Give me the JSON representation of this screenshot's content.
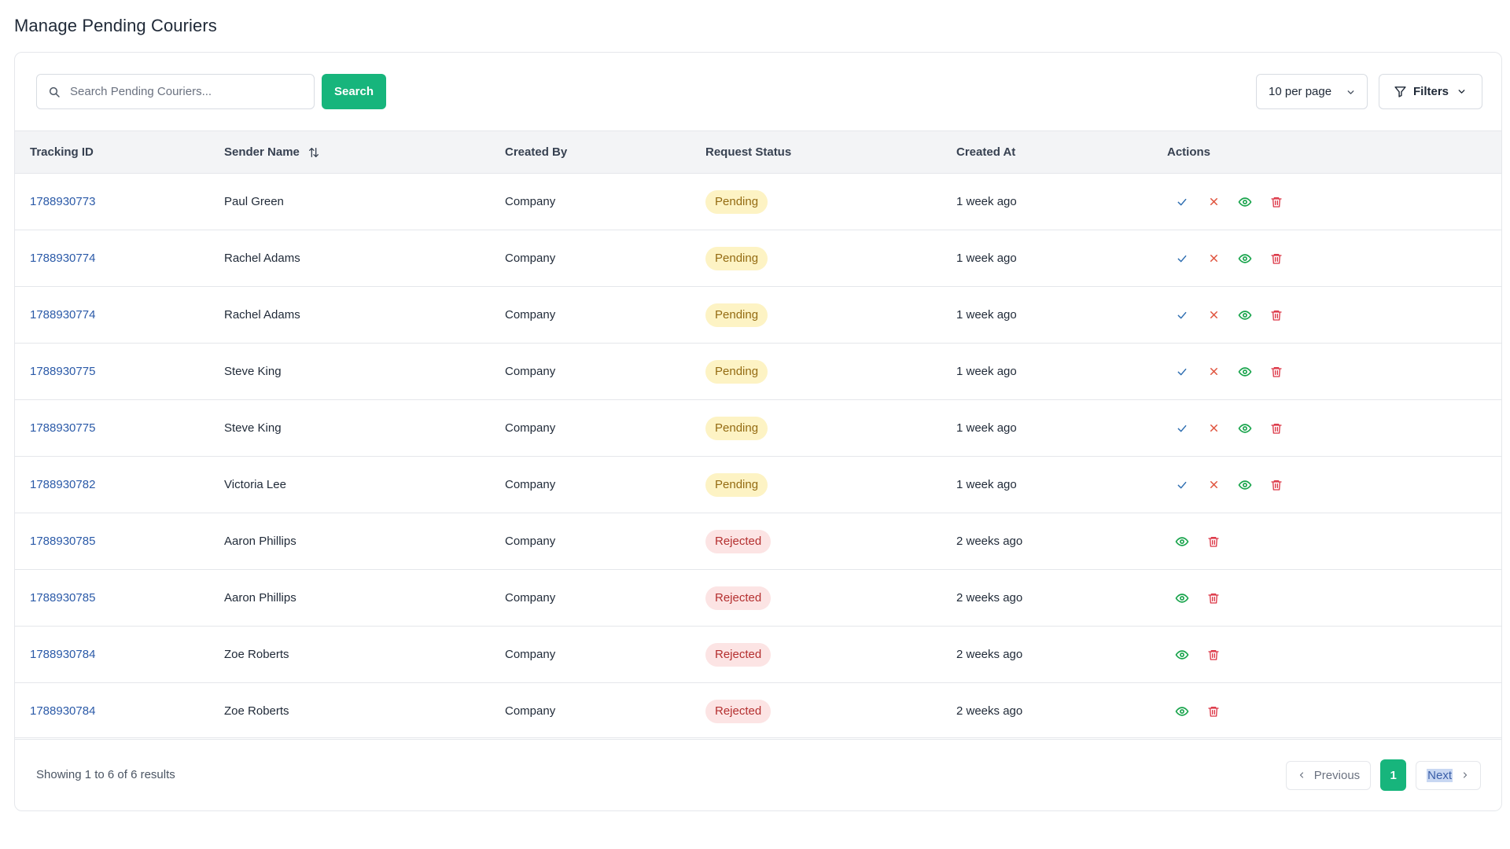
{
  "page": {
    "title": "Manage Pending Couriers"
  },
  "toolbar": {
    "search_placeholder": "Search Pending Couriers...",
    "search_label": "Search",
    "per_page": "10 per page",
    "filters_label": "Filters"
  },
  "table": {
    "headers": [
      "Tracking ID",
      "Sender Name",
      "Created By",
      "Request Status",
      "Created At",
      "Actions"
    ],
    "rows": [
      {
        "tracking_id": "1788930773",
        "sender": "Paul Green",
        "created_by": "Company",
        "status": "Pending",
        "created_at": "1 week ago"
      },
      {
        "tracking_id": "1788930774",
        "sender": "Rachel Adams",
        "created_by": "Company",
        "status": "Pending",
        "created_at": "1 week ago"
      },
      {
        "tracking_id": "1788930774",
        "sender": "Rachel Adams",
        "created_by": "Company",
        "status": "Pending",
        "created_at": "1 week ago"
      },
      {
        "tracking_id": "1788930775",
        "sender": "Steve King",
        "created_by": "Company",
        "status": "Pending",
        "created_at": "1 week ago"
      },
      {
        "tracking_id": "1788930775",
        "sender": "Steve King",
        "created_by": "Company",
        "status": "Pending",
        "created_at": "1 week ago"
      },
      {
        "tracking_id": "1788930782",
        "sender": "Victoria Lee",
        "created_by": "Company",
        "status": "Pending",
        "created_at": "1 week ago"
      },
      {
        "tracking_id": "1788930785",
        "sender": "Aaron Phillips",
        "created_by": "Company",
        "status": "Rejected",
        "created_at": "2 weeks ago"
      },
      {
        "tracking_id": "1788930785",
        "sender": "Aaron Phillips",
        "created_by": "Company",
        "status": "Rejected",
        "created_at": "2 weeks ago"
      },
      {
        "tracking_id": "1788930784",
        "sender": "Zoe Roberts",
        "created_by": "Company",
        "status": "Rejected",
        "created_at": "2 weeks ago"
      },
      {
        "tracking_id": "1788930784",
        "sender": "Zoe Roberts",
        "created_by": "Company",
        "status": "Rejected",
        "created_at": "2 weeks ago"
      }
    ]
  },
  "footer": {
    "showing": "Showing 1 to 6 of 6 results",
    "previous_label": "Previous",
    "current_page": "1",
    "next_label": "Next"
  },
  "icons": {
    "search": "search-icon",
    "chevron": "chevron-down-icon",
    "filter": "filter-icon",
    "sort": "sort-icon",
    "approve": "check-icon",
    "reject": "x-icon",
    "view": "eye-icon",
    "delete": "trash-icon"
  },
  "colors": {
    "accent": "#17b57c",
    "link": "#2b5aa8",
    "pending_bg": "#fdf3c4",
    "pending_text": "#946b12",
    "rejected_bg": "#fce4e4",
    "rejected_text": "#b42f2f",
    "approve": "#2b6cb0",
    "reject": "#e0533d",
    "view": "#16a34a",
    "delete": "#dc3545"
  }
}
